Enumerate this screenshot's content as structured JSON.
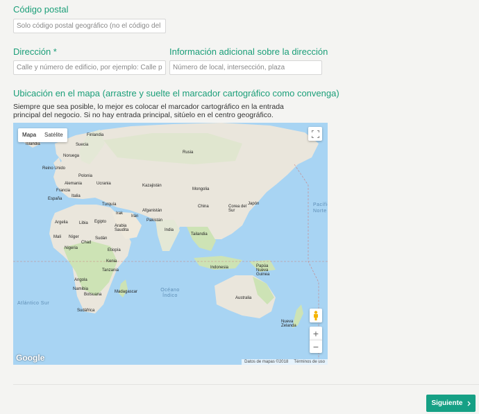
{
  "postal": {
    "label": "Código postal",
    "placeholder": "Solo código postal geográfico (no el código del país"
  },
  "address": {
    "label": "Dirección *",
    "placeholder": "Calle y número de edificio, por ejemplo: Calle princi"
  },
  "address_extra": {
    "label": "Información adicional sobre la dirección",
    "placeholder": "Número de local, intersección, plaza"
  },
  "map_section": {
    "title": "Ubicación en el mapa (arrastre y suelte el marcador cartográfico como convenga)",
    "help": "Siempre que sea posible, lo mejor es colocar el marcador cartográfico en la entrada principal del negocio. Si no hay entrada principal, sitúelo en el centro geográfico."
  },
  "map": {
    "type_map": "Mapa",
    "type_satellite": "Satélite",
    "zoom_in": "+",
    "zoom_out": "−",
    "logo": "Google",
    "data_credit": "Datos de mapas ©2018",
    "terms": "Términos de uso",
    "labels": {
      "finlandia": "Finlandia",
      "suecia": "Suecia",
      "islandia": "Islandia",
      "noruega": "Noruega",
      "rusia": "Rusia",
      "reino_unido": "Reino Unido",
      "polonia": "Polonia",
      "alemania": "Alemania",
      "ucrania": "Ucrania",
      "francia": "Francia",
      "italia": "Italia",
      "espana": "España",
      "kazajistan": "Kazajistán",
      "mongolia": "Mongolia",
      "turquia": "Turquía",
      "china": "China",
      "corea_sur": "Corea del Sur",
      "japon": "Japón",
      "argelia": "Argelia",
      "libia": "Libia",
      "egipto": "Egipto",
      "irak": "Irak",
      "iran": "Irán",
      "afganistan": "Afganistán",
      "pakistan": "Pakistán",
      "arabia_saudita": "Arabia Saudita",
      "india": "India",
      "tailandia": "Tailandia",
      "mali": "Mali",
      "niger": "Níger",
      "chad": "Chad",
      "sudan": "Sudán",
      "nigeria": "Nigeria",
      "etiopia": "Etiopía",
      "kenia": "Kenia",
      "tanzania": "Tanzania",
      "angola": "Angola",
      "namibia": "Namibia",
      "botsuana": "Botsuana",
      "madagascar": "Madagascar",
      "sudafrica": "Sudáfrica",
      "indonesia": "Indonesia",
      "papua": "Papúa Nueva Guinea",
      "australia": "Australia",
      "nueva_zelanda": "Nueva Zelanda",
      "oceano_indico": "Océano Índico",
      "atlantico_sur": "Atlántico Sur",
      "pacifico_norte": "Pacífico Norte"
    }
  },
  "footer": {
    "next_label": "Siguiente"
  },
  "colors": {
    "accent": "#16a085",
    "ocean": "#a8d4f3",
    "land": "#eae6dc",
    "vegetation": "#cde3b5"
  }
}
